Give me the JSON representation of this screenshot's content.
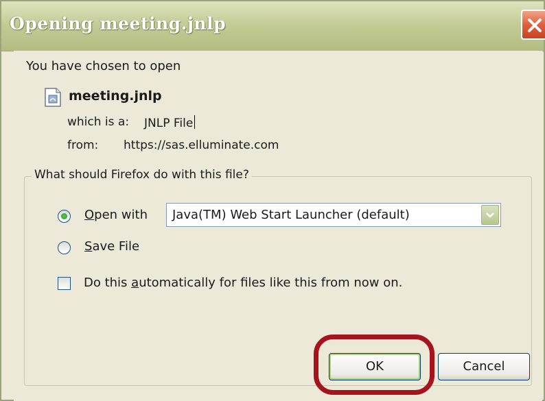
{
  "window": {
    "title": "Opening meeting.jnlp"
  },
  "file": {
    "intro": "You have chosen to open",
    "name": "meeting.jnlp",
    "type_label": "which is a:",
    "type_value": "JNLP File",
    "from_label": "from:",
    "from_value": "https://sas.elluminate.com"
  },
  "action": {
    "question": "What should Firefox do with this file?",
    "open_with_label": "Open with",
    "open_with_selected": true,
    "application": "Java(TM) Web Start Launcher (default)",
    "save_file_label": "Save File",
    "save_file_selected": false,
    "auto_label": "Do this automatically for files like this from now on.",
    "auto_checked": false
  },
  "buttons": {
    "ok": "OK",
    "cancel": "Cancel"
  },
  "icons": {
    "close": "close-icon",
    "file": "jnlp-file-icon",
    "dropdown": "chevron-down-icon"
  },
  "colors": {
    "titlebar": "#c4cc97",
    "close": "#e0603c",
    "highlight": "#a5141c",
    "dialog_bg": "#ece9d8"
  }
}
